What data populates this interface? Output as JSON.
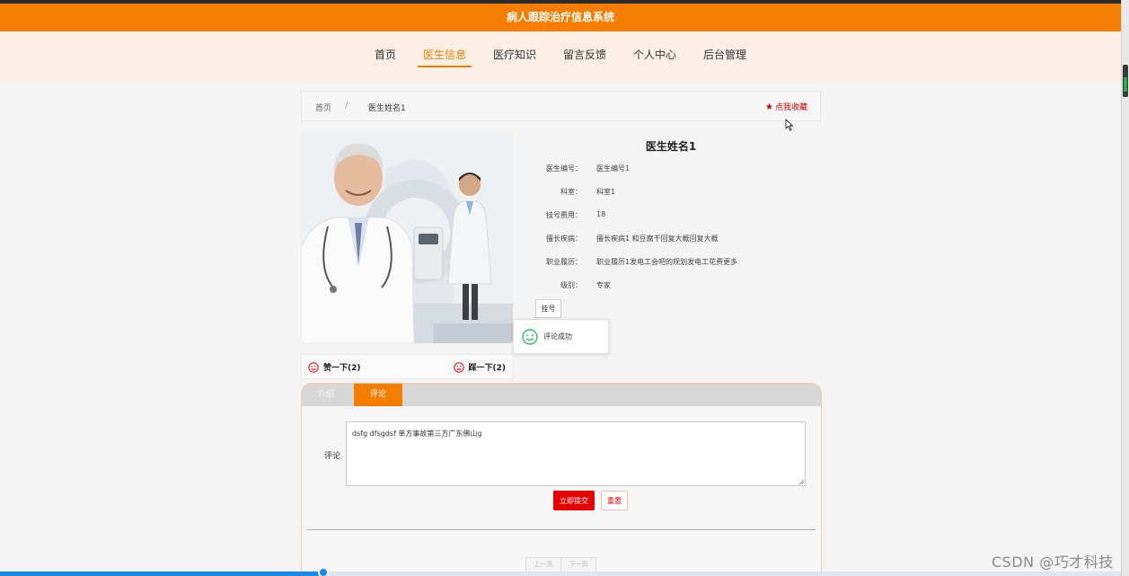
{
  "app": {
    "title": "病人跟踪治疗信息系统"
  },
  "nav": {
    "items": [
      {
        "label": "首页"
      },
      {
        "label": "医生信息"
      },
      {
        "label": "医疗知识"
      },
      {
        "label": "留言反馈"
      },
      {
        "label": "个人中心"
      },
      {
        "label": "后台管理"
      }
    ],
    "active_index": 1
  },
  "breadcrumb": {
    "home": "首页",
    "separator": "/",
    "current": "医生姓名1"
  },
  "favorite": {
    "label": "点我收藏",
    "icon": "star-icon",
    "color": "#cc0000"
  },
  "doctor": {
    "name": "医生姓名1",
    "fields": [
      {
        "label": "医生编号：",
        "value": "医生编号1"
      },
      {
        "label": "科室：",
        "value": "科室1"
      },
      {
        "label": "挂号费用：",
        "value": "18"
      },
      {
        "label": "擅长疾病：",
        "value": "擅长疾病1 和豆腐干回复大概回复大概"
      },
      {
        "label": "职业履历：",
        "value": "职业履历1发电工会吧的规划发电工花费更多"
      },
      {
        "label": "级别：",
        "value": "专家"
      }
    ],
    "register_label": "挂号"
  },
  "reactions": {
    "like_label": "赞一下(2)",
    "dislike_label": "踩一下(2)"
  },
  "toast": {
    "message": "评论成功"
  },
  "tabs": [
    {
      "label": "介绍"
    },
    {
      "label": "评论"
    }
  ],
  "comment_form": {
    "label": "评论",
    "value": "dsfg dfsgdsf 单方事故第三方广东佛山g",
    "submit_label": "立即提交",
    "reset_label": "重置"
  },
  "pager": {
    "prev_label": "上一页",
    "next_label": "下一页"
  },
  "video_progress": {
    "fraction": 0.29
  },
  "watermark": "CSDN @巧才科技",
  "colors": {
    "accent": "#f57d00",
    "danger": "#e60000",
    "success": "#2ebd6b"
  }
}
